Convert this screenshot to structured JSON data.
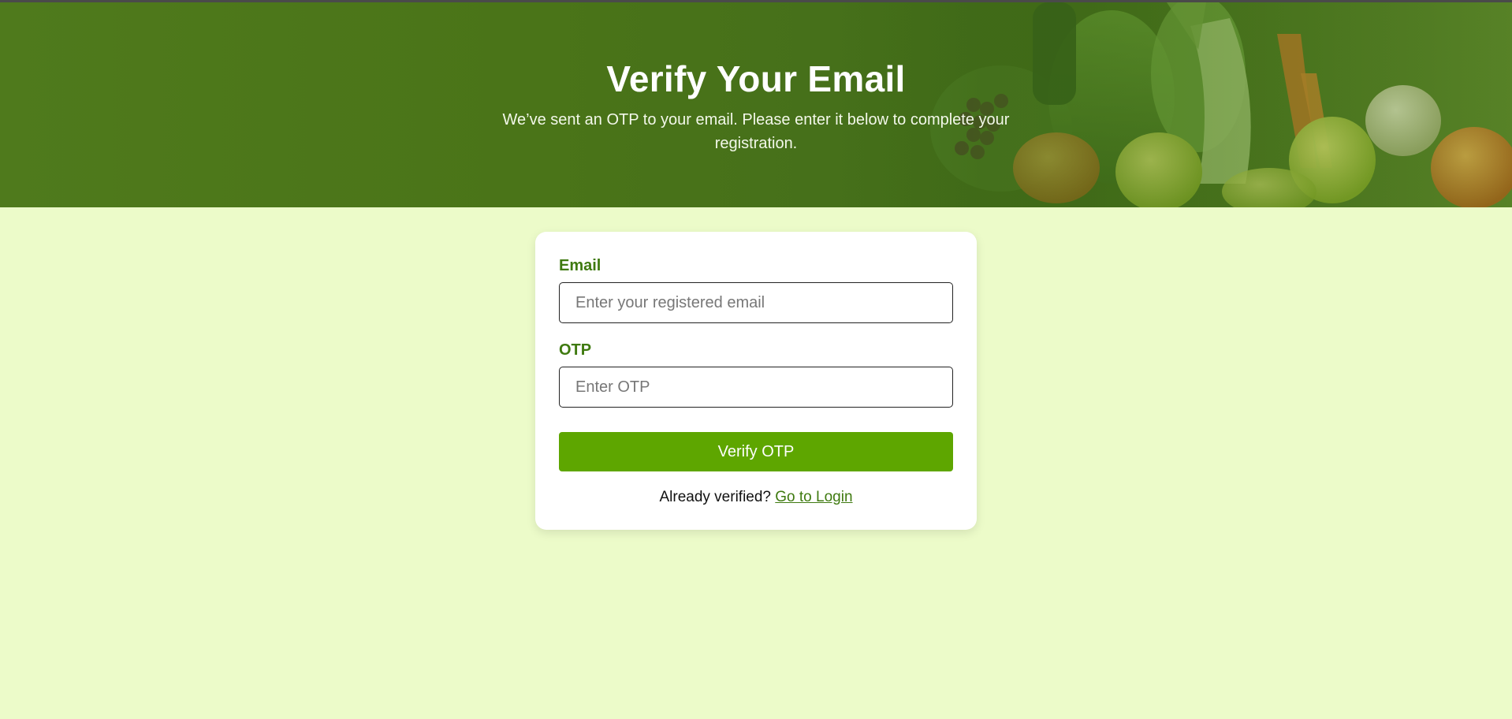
{
  "hero": {
    "title": "Verify Your Email",
    "subtitle": "We’ve sent an OTP to your email. Please enter it below to complete your registration."
  },
  "form": {
    "email": {
      "label": "Email",
      "placeholder": "Enter your registered email",
      "value": ""
    },
    "otp": {
      "label": "OTP",
      "placeholder": "Enter OTP",
      "value": ""
    },
    "submit_label": "Verify OTP",
    "footer_text": "Already verified?",
    "login_link_label": "Go to Login"
  },
  "colors": {
    "page_background": "#ecfbc9",
    "hero_green": "#4a7418",
    "accent_green": "#5ea600",
    "label_green": "#3f7a10"
  }
}
